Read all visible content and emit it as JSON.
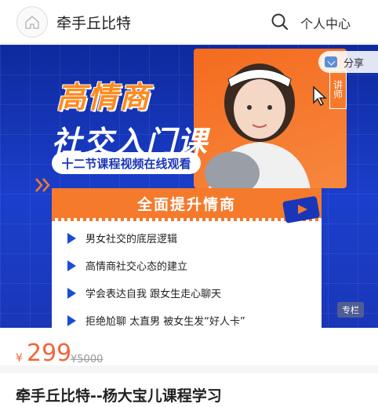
{
  "header": {
    "shop_name": "牵手丘比特",
    "search_icon": "search-icon",
    "user_center": "个人中心"
  },
  "banner": {
    "title_line1": "高情商",
    "title_line2": "社交入门课",
    "subtitle": "十二节课程视频在线观看",
    "card_title": "全面提升情商",
    "features": [
      "男女社交的底层逻辑",
      "高情商社交心态的建立",
      "学会表达自我 跟女生走心聊天",
      "拒绝尬聊 太直男 被女生发“好人卡”"
    ],
    "lecturer_label": "讲师",
    "share_label": "分享",
    "column_badge": "专栏"
  },
  "price": {
    "currency": "¥",
    "current": "299",
    "original": "¥5000"
  },
  "course": {
    "title": "牵手丘比特--杨大宝儿课程学习"
  }
}
